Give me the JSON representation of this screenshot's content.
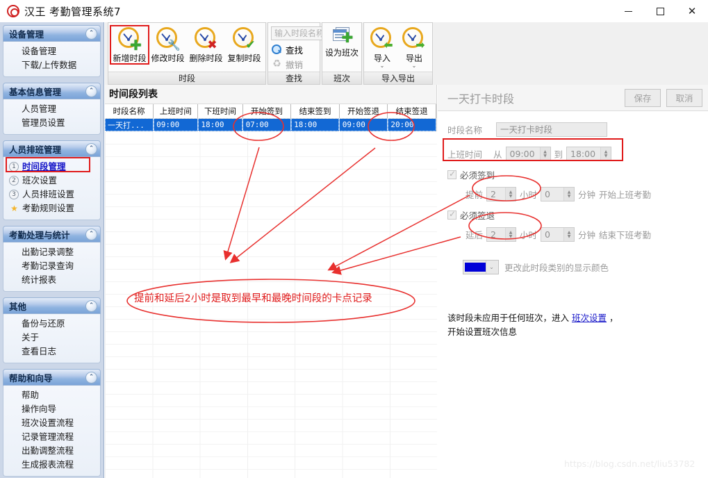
{
  "window": {
    "brand": "汉王",
    "app_title": "考勤管理系统7",
    "minimize_label": "—",
    "maximize_label": "□",
    "close_label": "✕"
  },
  "sidebar": {
    "groups": [
      {
        "title": "设备管理",
        "collapse_icon": "chevron-up-icon",
        "items": [
          {
            "label": "设备管理"
          },
          {
            "label": "下载/上传数据"
          }
        ]
      },
      {
        "title": "基本信息管理",
        "collapse_icon": "chevron-up-icon",
        "items": [
          {
            "label": "人员管理"
          },
          {
            "label": "管理员设置"
          }
        ]
      },
      {
        "title": "人员排班管理",
        "collapse_icon": "chevron-up-icon",
        "items": [
          {
            "label": "时间段管理",
            "badge": "1",
            "active": true
          },
          {
            "label": "班次设置",
            "badge": "2"
          },
          {
            "label": "人员排班设置",
            "badge": "3"
          },
          {
            "label": "考勤规则设置",
            "badge": "star"
          }
        ]
      },
      {
        "title": "考勤处理与统计",
        "collapse_icon": "chevron-up-icon",
        "items": [
          {
            "label": "出勤记录调整"
          },
          {
            "label": "考勤记录查询"
          },
          {
            "label": "统计报表"
          }
        ]
      },
      {
        "title": "其他",
        "collapse_icon": "chevron-up-icon",
        "items": [
          {
            "label": "备份与还原"
          },
          {
            "label": "关于"
          },
          {
            "label": "查看日志"
          }
        ]
      },
      {
        "title": "帮助和向导",
        "collapse_icon": "chevron-up-icon",
        "items": [
          {
            "label": "帮助"
          },
          {
            "label": "操作向导"
          },
          {
            "label": "班次设置流程"
          },
          {
            "label": "记录管理流程"
          },
          {
            "label": "出勤调整流程"
          },
          {
            "label": "生成报表流程"
          }
        ]
      }
    ]
  },
  "ribbon": {
    "groups": [
      {
        "caption": "时段",
        "buttons": [
          {
            "label": "新增时段",
            "icon": "clock-plus-icon",
            "selected": true
          },
          {
            "label": "修改时段",
            "icon": "clock-wrench-icon",
            "selected": false
          },
          {
            "label": "删除时段",
            "icon": "clock-delete-icon",
            "selected": false
          },
          {
            "label": "复制时段",
            "icon": "clock-check-icon",
            "selected": false
          }
        ]
      },
      {
        "caption": "查找",
        "search_placeholder": "输入时段名称",
        "find_label": "查找",
        "undo_label": "撤销"
      },
      {
        "caption": "班次",
        "buttons": [
          {
            "label": "设为班次",
            "icon": "list-add-icon",
            "selected": false
          }
        ]
      },
      {
        "caption": "导入导出",
        "buttons": [
          {
            "label": "导入",
            "icon": "clock-import-icon",
            "selected": false
          },
          {
            "label": "导出",
            "icon": "clock-export-icon",
            "selected": false
          }
        ]
      }
    ]
  },
  "list_panel": {
    "title": "时间段列表",
    "columns": [
      "时段名称",
      "上班时间",
      "下班时间",
      "开始签到",
      "结束签到",
      "开始签退",
      "结束签退"
    ],
    "rows": [
      [
        "一天打...",
        "09:00",
        "18:00",
        "07:00",
        "18:00",
        "09:00",
        "20:00"
      ]
    ]
  },
  "detail_panel": {
    "title": "一天打卡时段",
    "save_label": "保存",
    "cancel_label": "取消",
    "name_label": "时段名称",
    "name_value": "一天打卡时段",
    "work_time_label": "上班时间",
    "from_label": "从",
    "to_label": "到",
    "start_value": "09:00",
    "end_value": "18:00",
    "must_checkin_label": "必须签到",
    "checkin_lead_label": "提前",
    "checkin_hours": "2",
    "checkin_hours_unit": "小时",
    "checkin_minutes": "0",
    "checkin_minutes_unit": "分钟",
    "checkin_tail": "开始上班考勤",
    "must_checkout_label": "必须签退",
    "checkout_lead_label": "延后",
    "checkout_hours": "2",
    "checkout_hours_unit": "小时",
    "checkout_minutes": "0",
    "checkout_minutes_unit": "分钟",
    "checkout_tail": "结束下班考勤",
    "color_label": "更改此时段类别的显示颜色",
    "color_value": "#0000d8",
    "note_line1_pre": "该时段未应用于任何班次，进入 ",
    "note_link": "班次设置",
    "note_line1_post": " ，",
    "note_line2": "开始设置班次信息"
  },
  "annotation": {
    "text": "提前和延后2小时是取到最早和最晚时间段的卡点记录",
    "color": "#e8302e"
  },
  "watermark": "https://blog.csdn.net/liu53782"
}
